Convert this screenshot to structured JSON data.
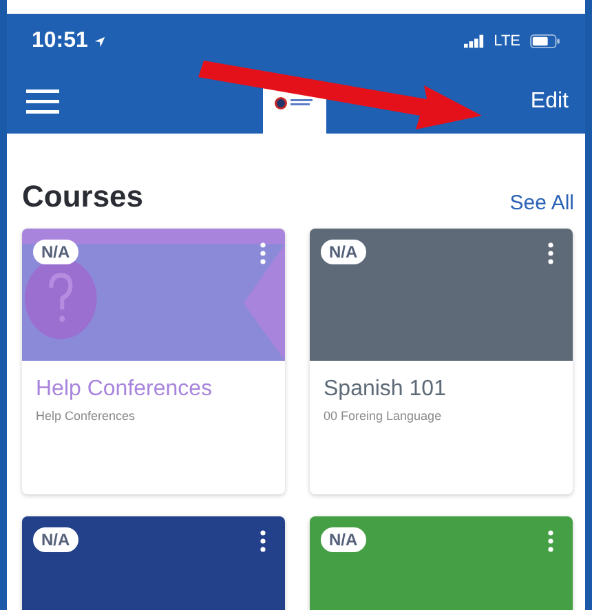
{
  "status_bar": {
    "time": "10:51",
    "network": "LTE"
  },
  "nav_bar": {
    "action": "Edit"
  },
  "section": {
    "title": "Courses",
    "link": "See All"
  },
  "courses": [
    {
      "badge": "N/A",
      "title": "Help Conferences",
      "subtitle": "Help Conferences",
      "color": "#a884dc",
      "kind": "banner"
    },
    {
      "badge": "N/A",
      "title": "Spanish 101",
      "subtitle": "00 Foreing Language",
      "color": "#5e6a77",
      "kind": "plain"
    },
    {
      "badge": "N/A",
      "color": "#22418a",
      "kind": "plain"
    },
    {
      "badge": "N/A",
      "color": "#45a045",
      "kind": "plain"
    }
  ]
}
